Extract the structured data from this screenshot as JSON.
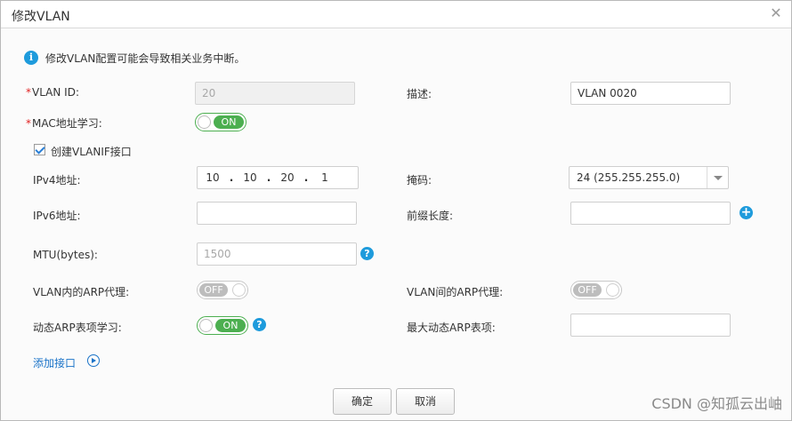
{
  "window": {
    "title": "修改VLAN",
    "close_icon": "close-icon"
  },
  "info": {
    "icon": "info-icon",
    "text": "修改VLAN配置可能会导致相关业务中断。"
  },
  "form": {
    "vlan_id": {
      "required_mark": "*",
      "label": "VLAN ID:",
      "value": "20"
    },
    "description": {
      "label": "描述:",
      "value": "VLAN 0020"
    },
    "mac_learning": {
      "required_mark": "*",
      "label": "MAC地址学习:",
      "state": "ON"
    },
    "create_vlanif": {
      "label": "创建VLANIF接口",
      "checked": true
    },
    "ipv4": {
      "label": "IPv4地址:",
      "octets": [
        "10",
        "10",
        "20",
        "1"
      ]
    },
    "mask": {
      "label": "掩码:",
      "selected": "24 (255.255.255.0)"
    },
    "ipv6": {
      "label": "IPv6地址:",
      "value": ""
    },
    "prefix_length": {
      "label": "前缀长度:",
      "value": ""
    },
    "mtu": {
      "label": "MTU(bytes):",
      "placeholder": "1500"
    },
    "arp_proxy_inner": {
      "label": "VLAN内的ARP代理:",
      "state": "OFF"
    },
    "arp_proxy_inter": {
      "label": "VLAN间的ARP代理:",
      "state": "OFF"
    },
    "dynamic_arp_learning": {
      "label": "动态ARP表项学习:",
      "state": "ON"
    },
    "max_dynamic_arp": {
      "label": "最大动态ARP表项:",
      "value": ""
    }
  },
  "add_interface": {
    "label": "添加接口"
  },
  "buttons": {
    "ok": "确定",
    "cancel": "取消"
  },
  "watermark": "CSDN @知孤云出岫",
  "colors": {
    "accent": "#1e9bdc",
    "toggle_on": "#4caf50",
    "toggle_off": "#bdbdbd",
    "link": "#1a73c8",
    "required": "#e02020"
  }
}
